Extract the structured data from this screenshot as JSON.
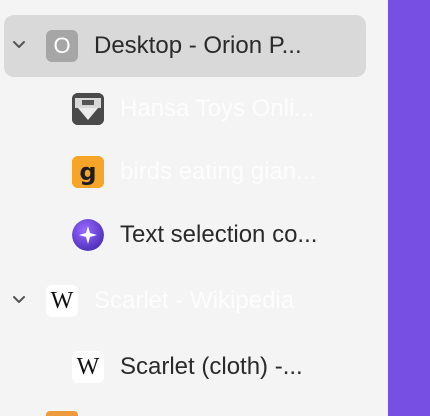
{
  "tabs": [
    {
      "title": "Desktop - Orion P...",
      "favicon": "orion-o-icon",
      "expanded": true,
      "selected": true,
      "depth": 0
    },
    {
      "title": "Hansa Toys Onli...",
      "favicon": "hansa-toys-icon",
      "depth": 1
    },
    {
      "title": "birds eating gian...",
      "favicon": "g-letter-icon",
      "depth": 1
    },
    {
      "title": "Text selection co...",
      "favicon": "orion-star-icon",
      "depth": 1
    },
    {
      "title": "Scarlet - Wikipedia",
      "favicon": "wikipedia-icon",
      "expanded": true,
      "depth": 0
    },
    {
      "title": "Scarlet (cloth) -...",
      "favicon": "wikipedia-icon",
      "depth": 1
    }
  ],
  "colors": {
    "sidebar_bg": "#f4f4f4",
    "selected_row": "#d9d9d9",
    "accent_panel": "#7750e3",
    "text": "#2a2a2a"
  },
  "icons": {
    "orion_letter": "O",
    "wiki_letter": "W"
  }
}
